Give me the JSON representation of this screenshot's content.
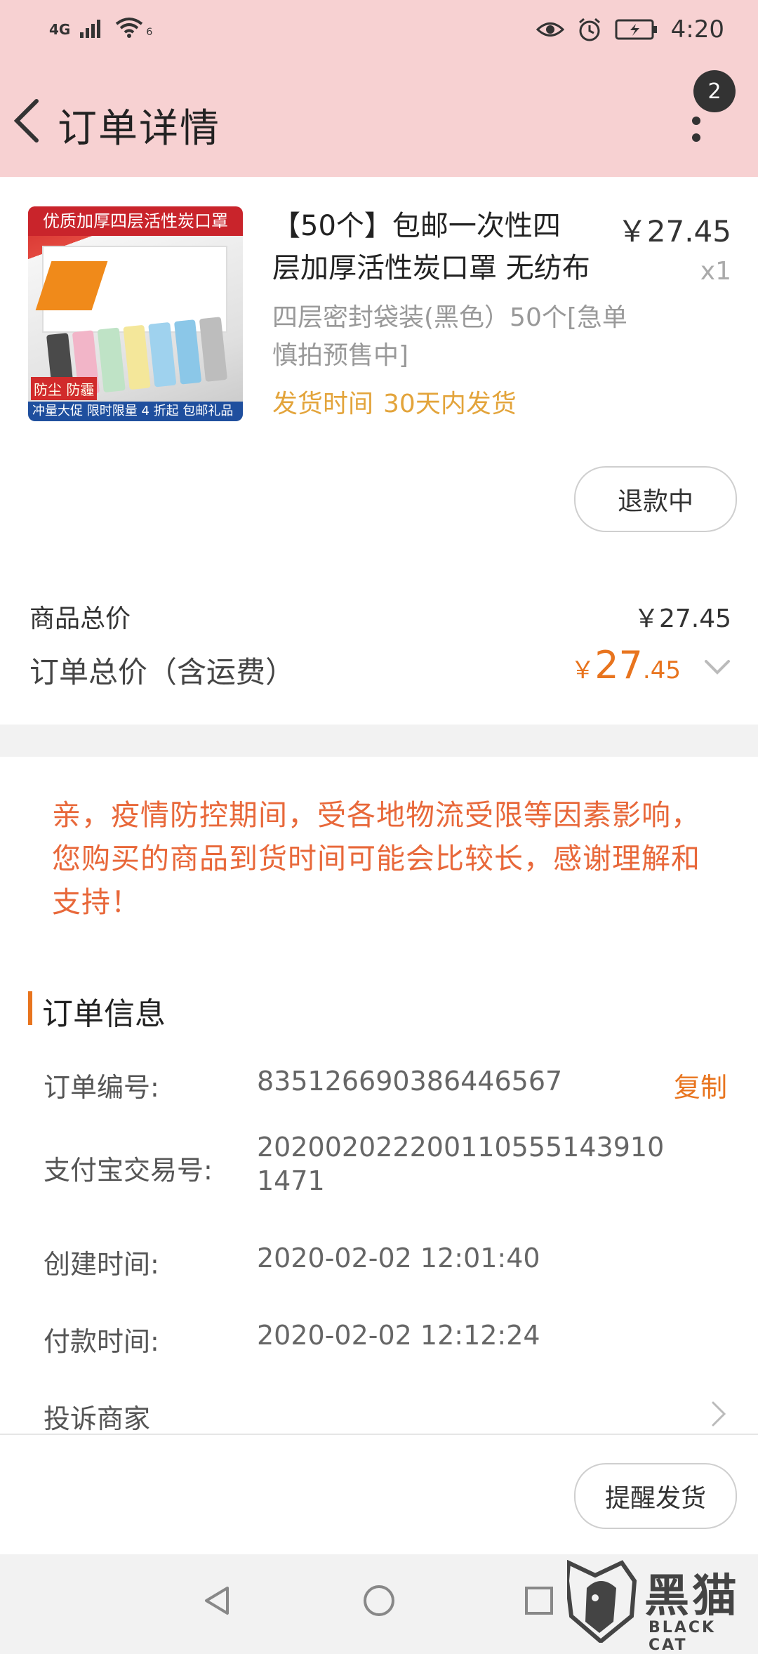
{
  "status_bar": {
    "network": "4G",
    "wifi_badge": "6",
    "time": "4:20"
  },
  "header": {
    "title": "订单详情",
    "badge_count": "2"
  },
  "product": {
    "image_band_text": "优质加厚四层活性炭口罩",
    "image_tag_text": "防尘 防霾",
    "image_promo_text": "冲量大促  限时限量 4 折起 包邮礼品",
    "name_line1": "【50个】包邮一次性四",
    "name_line2": "层加厚活性炭口罩 无纺布",
    "price": "￥27.45",
    "quantity": "x1",
    "sku": "四层密封袋装(黑色）50个[急单慎拍预售中]",
    "ship_label": "发货时间",
    "ship_value": "30天内发货",
    "refund_button": "退款中"
  },
  "summary": {
    "goods_total_label": "商品总价",
    "goods_total_value": "￥27.45",
    "order_total_label": "订单总价（含运费）",
    "order_total_yen": "￥",
    "order_total_int": "27",
    "order_total_dec": ".45"
  },
  "notice": "亲，疫情防控期间，受各地物流受限等因素影响，您购买的商品到货时间可能会比较长，感谢理解和支持！",
  "order_info": {
    "section_title": "订单信息",
    "order_no_label": "订单编号:",
    "order_no_value": "835126690386446567",
    "copy_label": "复制",
    "alipay_label": "支付宝交易号:",
    "alipay_value_line1": "2020020222001105551439​10",
    "alipay_value_line2": "1471",
    "created_label": "创建时间:",
    "created_value": "2020-02-02 12:01:40",
    "paid_label": "付款时间:",
    "paid_value": "2020-02-02 12:12:24",
    "complaint_label": "投诉商家"
  },
  "actions": {
    "remind_button": "提醒发货"
  },
  "watermark": {
    "title": "黑猫",
    "subtitle": "BLACK CAT"
  },
  "colors": {
    "header_bg": "#f7d1d2",
    "accent": "#e8741e",
    "notice": "#e8683a",
    "ship": "#e3a43b"
  }
}
